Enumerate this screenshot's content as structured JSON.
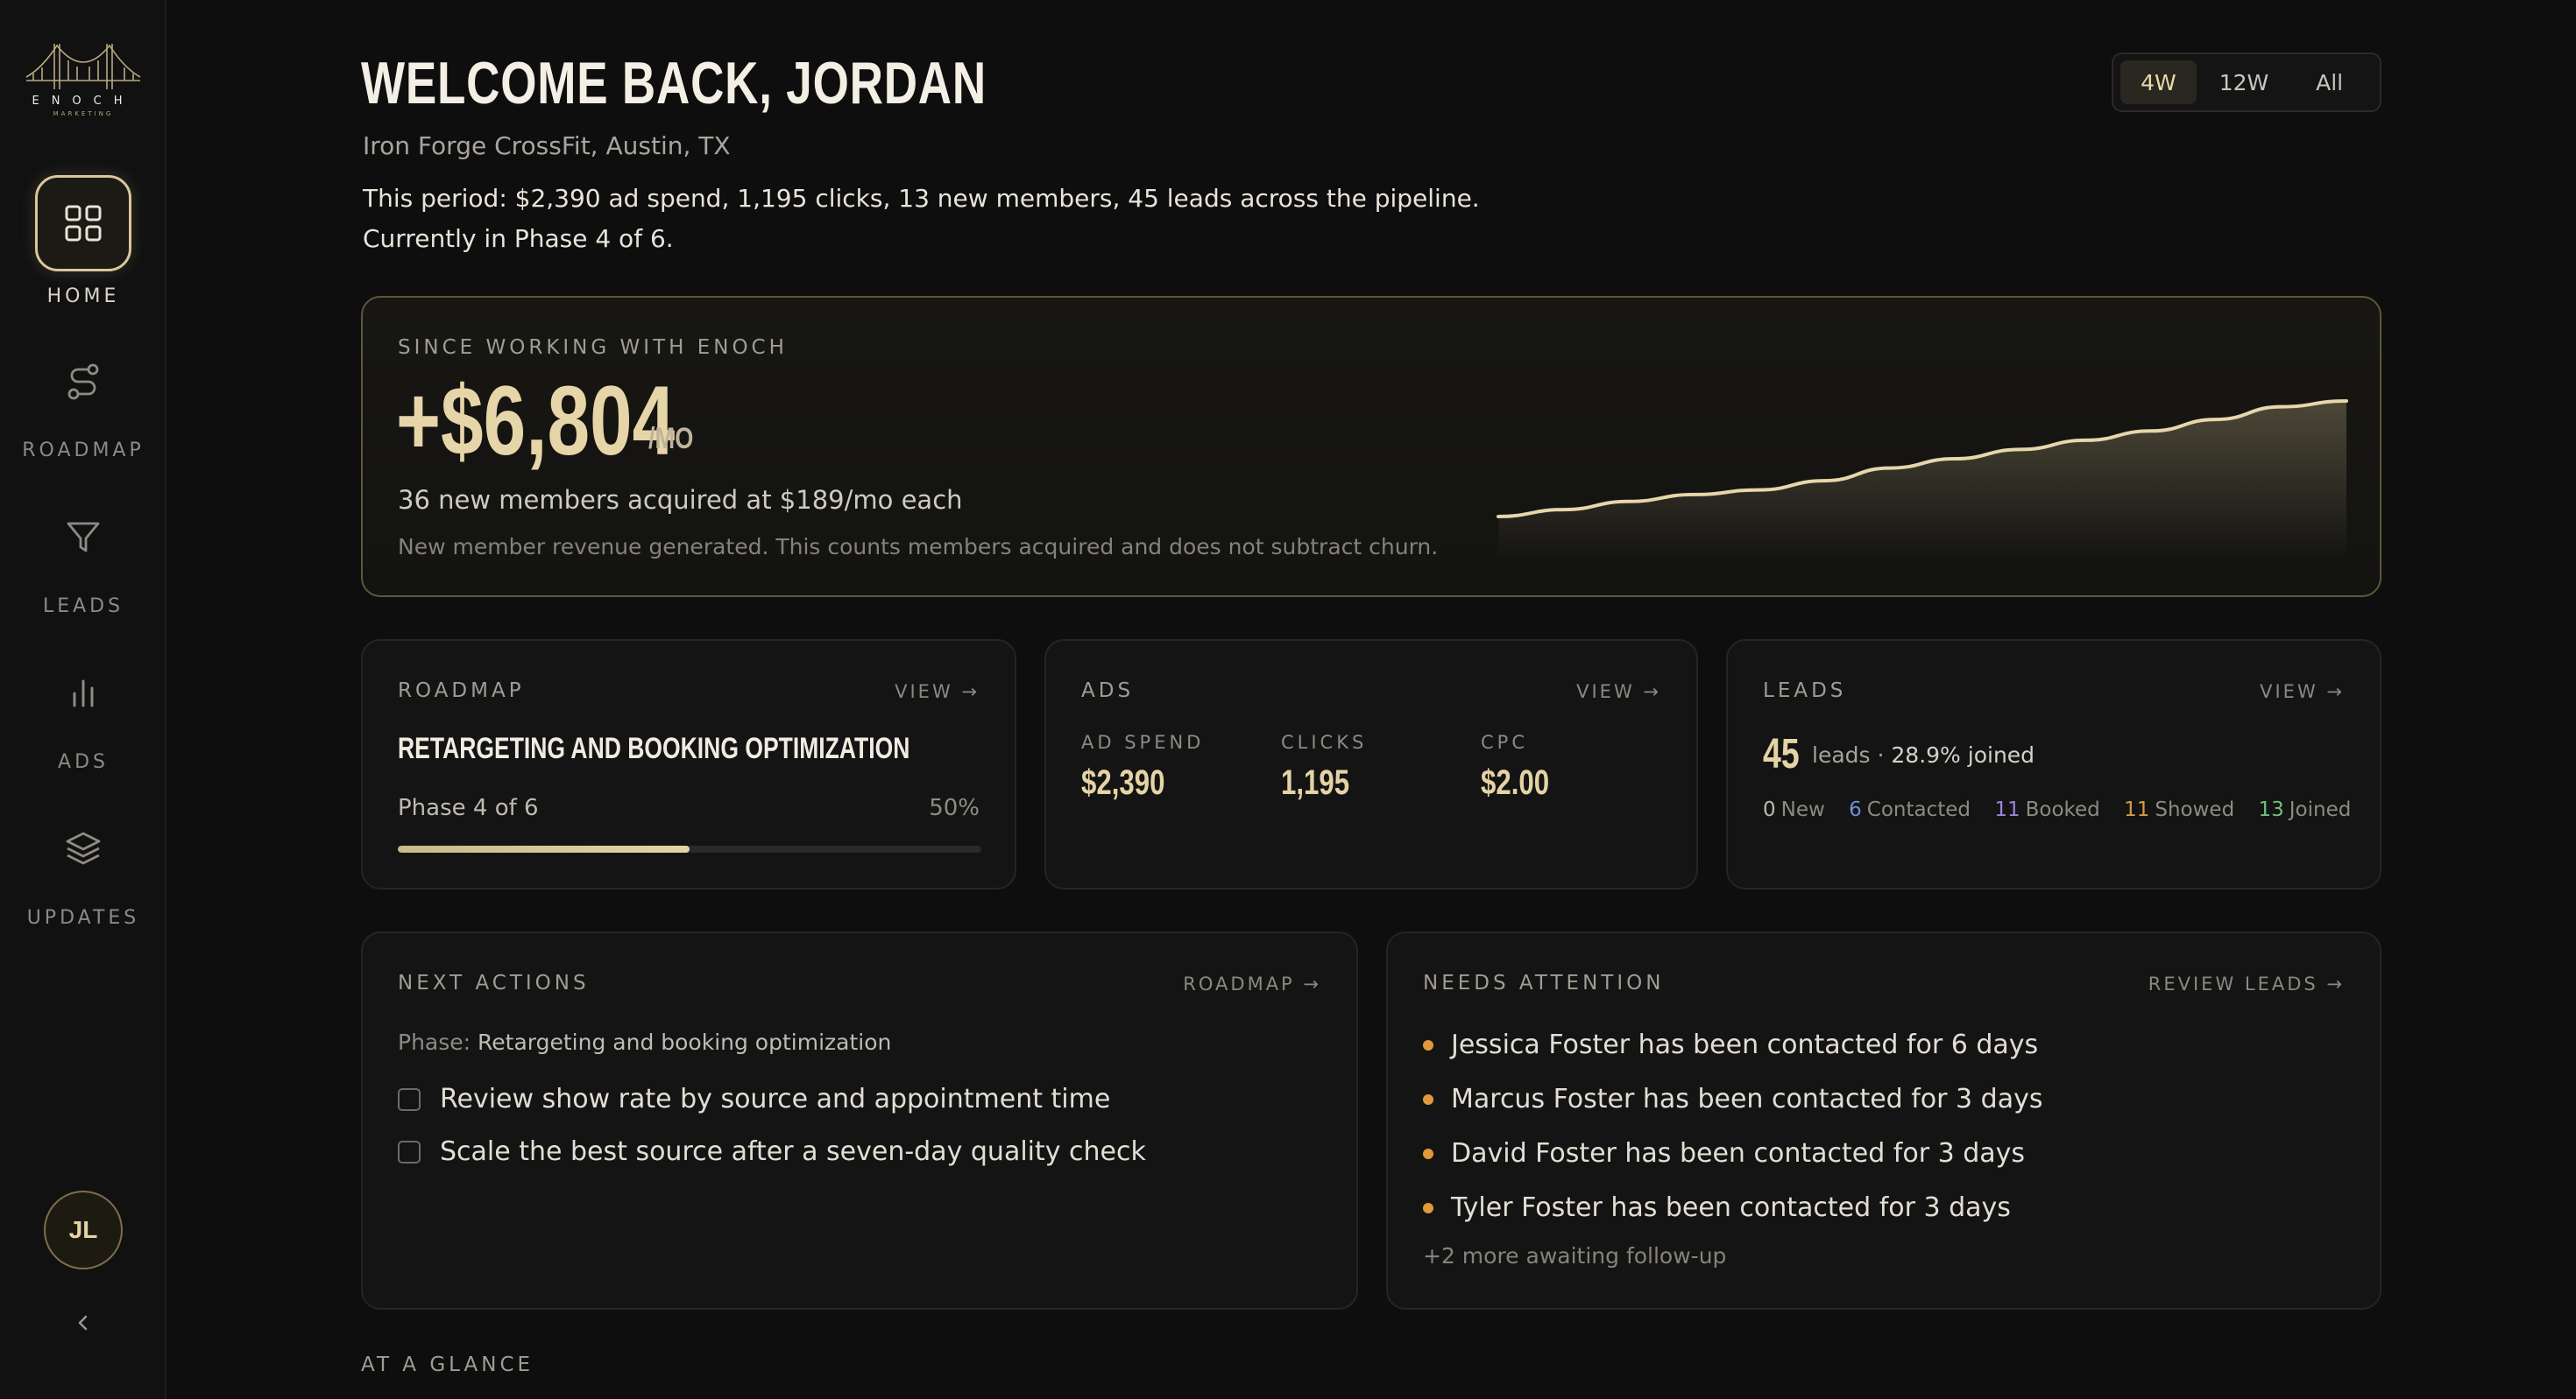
{
  "brand": {
    "name": "ENOCH",
    "tagline": "MARKETING"
  },
  "nav": {
    "items": [
      {
        "label": "HOME",
        "icon": "grid-icon",
        "active": true
      },
      {
        "label": "ROADMAP",
        "icon": "route-icon",
        "active": false
      },
      {
        "label": "LEADS",
        "icon": "funnel-icon",
        "active": false
      },
      {
        "label": "ADS",
        "icon": "bar-chart-icon",
        "active": false
      },
      {
        "label": "UPDATES",
        "icon": "layers-icon",
        "active": false
      }
    ],
    "avatar_initials": "JL"
  },
  "header": {
    "title": "WELCOME BACK, JORDAN",
    "gym": "Iron Forge CrossFit, Austin, TX",
    "summary_line1": "This period: $2,390 ad spend, 1,195 clicks, 13 new members, 45 leads across the pipeline.",
    "summary_line2": "Currently in Phase 4 of 6."
  },
  "range": {
    "options": [
      "4W",
      "12W",
      "All"
    ],
    "selected": "4W"
  },
  "hero": {
    "eyebrow": "SINCE WORKING WITH ENOCH",
    "value": "+$6,804",
    "unit": "/MO",
    "sub": "36 new members acquired at $189/mo each",
    "note": "New member revenue generated. This counts members acquired and does not subtract churn.",
    "trend": [
      0.0,
      0.06,
      0.13,
      0.19,
      0.23,
      0.31,
      0.42,
      0.5,
      0.58,
      0.66,
      0.74,
      0.84,
      0.95,
      1.0
    ]
  },
  "roadmap_card": {
    "eyebrow": "ROADMAP",
    "link": "VIEW →",
    "title": "RETARGETING AND BOOKING OPTIMIZATION",
    "phase": "Phase 4 of 6",
    "percent_label": "50%",
    "progress": 0.5
  },
  "ads_card": {
    "eyebrow": "ADS",
    "link": "VIEW →",
    "metrics": [
      {
        "label": "AD SPEND",
        "value": "$2,390"
      },
      {
        "label": "CLICKS",
        "value": "1,195"
      },
      {
        "label": "CPC",
        "value": "$2.00"
      }
    ]
  },
  "leads_card": {
    "eyebrow": "LEADS",
    "link": "VIEW →",
    "count": "45",
    "sub_label": "leads ·",
    "joined_rate": "28.9% joined",
    "stages": [
      {
        "n": "0",
        "label": "New",
        "color": "#bdb9b0"
      },
      {
        "n": "6",
        "label": "Contacted",
        "color": "#6f8fd6"
      },
      {
        "n": "11",
        "label": "Booked",
        "color": "#9a86d6"
      },
      {
        "n": "11",
        "label": "Showed",
        "color": "#d79a4a"
      },
      {
        "n": "13",
        "label": "Joined",
        "color": "#6fbf7a"
      }
    ]
  },
  "next_actions": {
    "eyebrow": "NEXT ACTIONS",
    "link": "ROADMAP →",
    "phase_label": "Phase:",
    "phase_value": "Retargeting and booking optimization",
    "items": [
      "Review show rate by source and appointment time",
      "Scale the best source after a seven-day quality check"
    ]
  },
  "needs_attention": {
    "eyebrow": "NEEDS ATTENTION",
    "link": "REVIEW LEADS →",
    "items": [
      "Jessica Foster has been contacted for 6 days",
      "Marcus Foster has been contacted for 3 days",
      "David Foster has been contacted for 3 days",
      "Tyler Foster has been contacted for 3 days"
    ],
    "more": "+2 more awaiting follow-up"
  },
  "glance": "AT A GLANCE"
}
